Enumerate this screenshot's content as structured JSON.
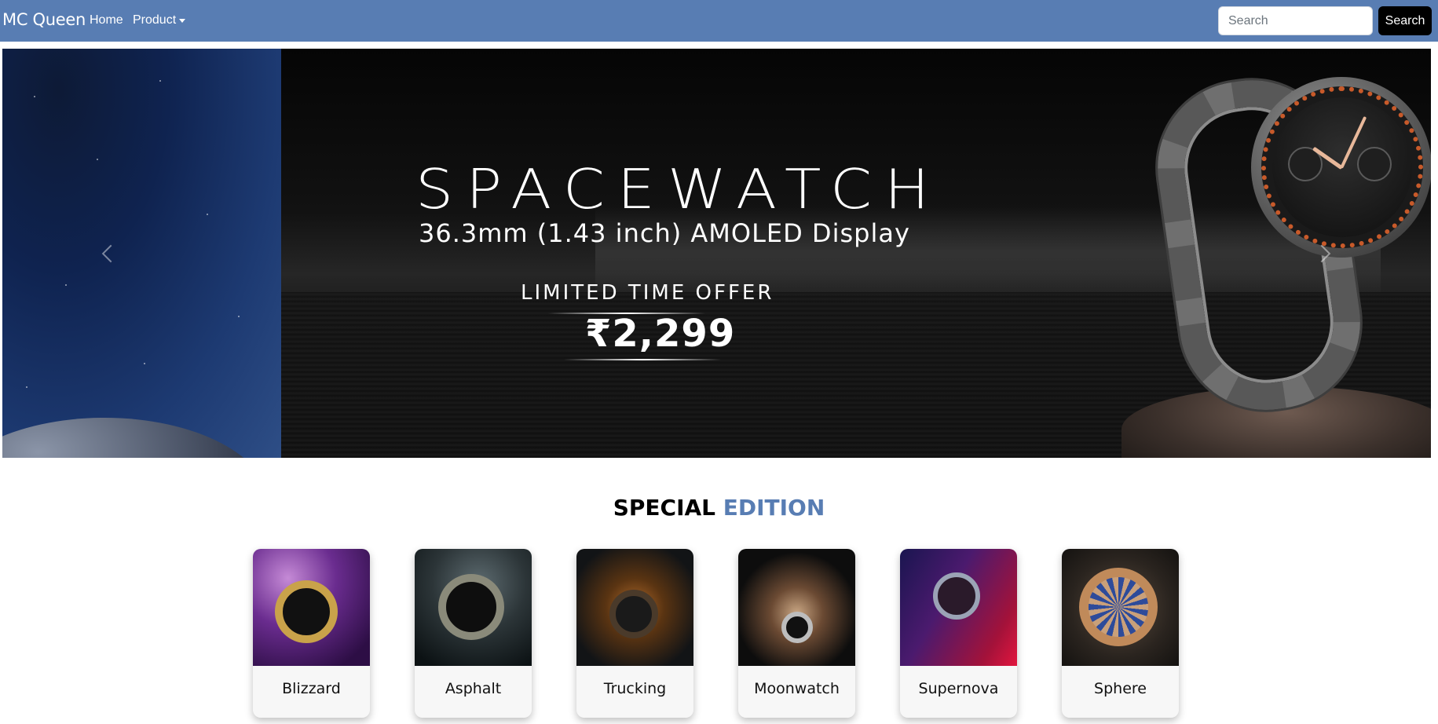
{
  "navbar": {
    "brand": "MC Queen",
    "links": {
      "home": "Home",
      "product": "Product"
    },
    "search": {
      "placeholder": "Search",
      "button_label": "Search"
    }
  },
  "hero": {
    "headline": "SPACEWATCH",
    "subline": "36.3mm (1.43 inch) AMOLED Display",
    "offer": "LIMITED TIME OFFER",
    "price": "₹2,299",
    "controls": {
      "prev_icon": "chevron-left-icon",
      "next_icon": "chevron-right-icon"
    }
  },
  "special_edition": {
    "title_part1": "SPECIAL",
    "title_part2": "EDITION",
    "accent_color": "#587db3",
    "cards": [
      {
        "label": "Blizzard"
      },
      {
        "label": "Asphalt"
      },
      {
        "label": "Trucking"
      },
      {
        "label": "Moonwatch"
      },
      {
        "label": "Supernova"
      },
      {
        "label": "Sphere"
      }
    ]
  },
  "colors": {
    "navbar": "#587db3",
    "search_button": "#000000"
  }
}
